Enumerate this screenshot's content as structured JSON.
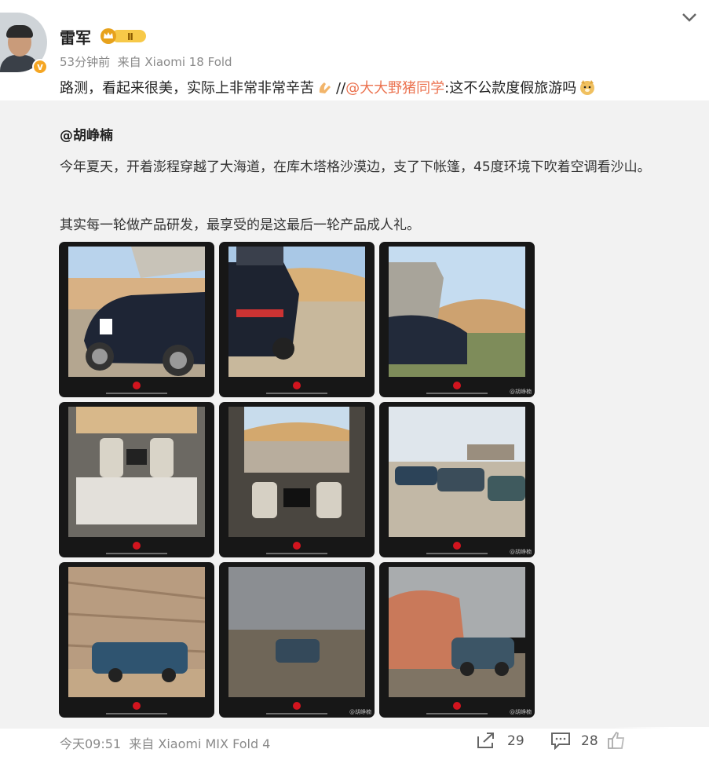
{
  "header": {
    "username": "雷军",
    "rank_badge": "Ⅱ",
    "time": "53分钟前",
    "source": "来自 Xiaomi 18 Fold",
    "verified_mark": "v"
  },
  "post": {
    "text_before": "路测，看起来很美，实际上非常非常辛苦",
    "separator": "//",
    "mention": "@大大野猪同学",
    "after_mention": ":这不公款度假旅游吗",
    "emoji_1": "praying-hands-emoji",
    "emoji_2": "doge-emoji"
  },
  "repost": {
    "author": "@胡峥楠",
    "paragraph_1": "今年夏天，开着澎程穿越了大海道，在库木塔格沙漠边，支了下帐篷，45度环境下吹着空调看沙山。",
    "paragraph_2": "其实每一轮做产品研发，最享受的是这最后一轮产品成人礼。",
    "photo_watermark": "@胡峥楠",
    "photos": [
      {
        "desc": "suv-tent-desert"
      },
      {
        "desc": "suv-rear-desert"
      },
      {
        "desc": "tent-awning-dunes"
      },
      {
        "desc": "interior-table"
      },
      {
        "desc": "interior-dunes"
      },
      {
        "desc": "suvs-stone-sign"
      },
      {
        "desc": "suv-cliff"
      },
      {
        "desc": "suv-stormy-sky"
      },
      {
        "desc": "suv-red-rock"
      }
    ]
  },
  "footer": {
    "time": "今天09:51",
    "source": "来自 Xiaomi MIX Fold 4",
    "repost_count": "29",
    "comment_count": "28"
  },
  "colors": {
    "mention": "#eb7350",
    "repost_bg": "#f2f2f2",
    "verified": "#f5a623"
  }
}
